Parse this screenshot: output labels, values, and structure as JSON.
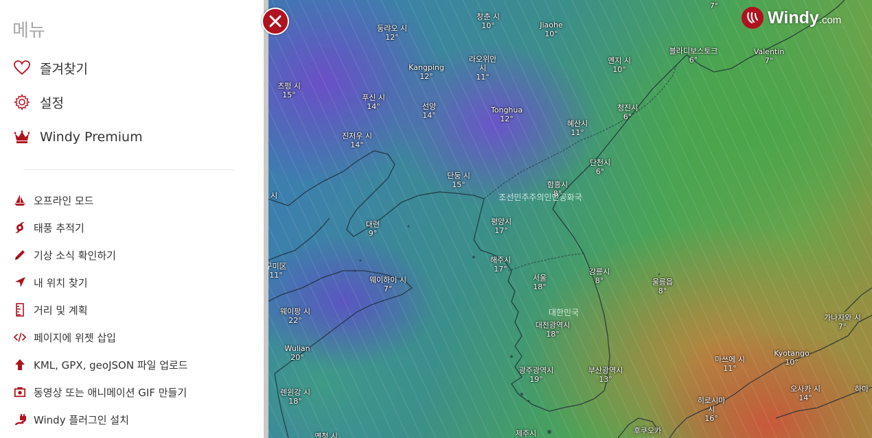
{
  "sidebar": {
    "title": "메뉴",
    "main_items": [
      {
        "label": "즐겨찾기",
        "icon": "heart-icon"
      },
      {
        "label": "설정",
        "icon": "gear-icon"
      },
      {
        "label": "Windy Premium",
        "icon": "crown-icon"
      }
    ],
    "sub_items": [
      {
        "label": "오프라인 모드",
        "icon": "sailboat-icon"
      },
      {
        "label": "태풍 추적기",
        "icon": "hurricane-icon"
      },
      {
        "label": "기상 소식 확인하기",
        "icon": "pencil-icon"
      },
      {
        "label": "내 위치 찾기",
        "icon": "location-arrow-icon"
      },
      {
        "label": "거리 및 계획",
        "icon": "ruler-icon"
      },
      {
        "label": "페이지에 위젯 삽입",
        "icon": "code-icon"
      },
      {
        "label": "KML, GPX, geoJSON 파일 업로드",
        "icon": "upload-icon"
      },
      {
        "label": "동영상 또는 애니메이션 GIF 만들기",
        "icon": "camera-icon"
      },
      {
        "label": "Windy 플러그인 설치",
        "icon": "plugin-icon"
      }
    ]
  },
  "logo": {
    "word": "Windy",
    "domain": ".com"
  },
  "colors": {
    "brand": "#b0121f",
    "text": "#333333",
    "title": "#a7a7a7"
  },
  "map": {
    "cities": [
      {
        "name": "창춘 시",
        "temp": "10°"
      },
      {
        "name": "Jiaohe",
        "temp": "10°"
      },
      {
        "name": "둥랴오 시",
        "temp": "12°"
      },
      {
        "name": "라오위안 시",
        "temp": "11°"
      },
      {
        "name": "Kangping",
        "temp": "12°"
      },
      {
        "name": "옌지 시",
        "temp": "10°"
      },
      {
        "name": "블라디보스토크",
        "temp": "6°"
      },
      {
        "name": "Valentin",
        "temp": "7°"
      },
      {
        "name": "츠펑 시",
        "temp": "15°"
      },
      {
        "name": "푸신 시",
        "temp": "14°"
      },
      {
        "name": "선양",
        "temp": "14°"
      },
      {
        "name": "Tonghua",
        "temp": "12°"
      },
      {
        "name": "청진시",
        "temp": "6°"
      },
      {
        "name": "혜산시",
        "temp": "11°"
      },
      {
        "name": "진저우 시",
        "temp": "14°"
      },
      {
        "name": "단천시",
        "temp": "6°"
      },
      {
        "name": "단둥 시",
        "temp": "15°"
      },
      {
        "name": "함흥시",
        "temp": "8°"
      },
      {
        "name": "대련",
        "temp": "9°"
      },
      {
        "name": "평양시",
        "temp": "17°"
      },
      {
        "name": "해주시",
        "temp": "17°"
      },
      {
        "name": "서울",
        "temp": "18°"
      },
      {
        "name": "강릉시",
        "temp": "8°"
      },
      {
        "name": "울릉읍",
        "temp": "8°"
      },
      {
        "name": "웨이하이 시",
        "temp": "7°"
      },
      {
        "name": "웨이팡 시",
        "temp": "22°"
      },
      {
        "name": "대전광역시",
        "temp": "18°"
      },
      {
        "name": "가나자와 시",
        "temp": "7°"
      },
      {
        "name": "Wulian",
        "temp": "20°"
      },
      {
        "name": "마쓰에 시",
        "temp": "11°"
      },
      {
        "name": "Kyotango",
        "temp": "10°"
      },
      {
        "name": "광주광역시",
        "temp": "19°"
      },
      {
        "name": "부산광역시",
        "temp": "13°"
      },
      {
        "name": "렌윈강 시",
        "temp": "18°"
      },
      {
        "name": "오사카 시",
        "temp": "14°"
      },
      {
        "name": "히로시마 시",
        "temp": "16°"
      },
      {
        "name": "구미区",
        "temp": "11°"
      },
      {
        "name": "시",
        "temp": ""
      },
      {
        "name": "",
        "temp": "7°"
      },
      {
        "name": "하마",
        "temp": ""
      },
      {
        "name": "제주시",
        "temp": ""
      },
      {
        "name": "후쿠오카",
        "temp": ""
      },
      {
        "name": "옌청 시",
        "temp": ""
      }
    ],
    "countries": [
      "조선민주주의인민공화국",
      "대한민국"
    ]
  }
}
